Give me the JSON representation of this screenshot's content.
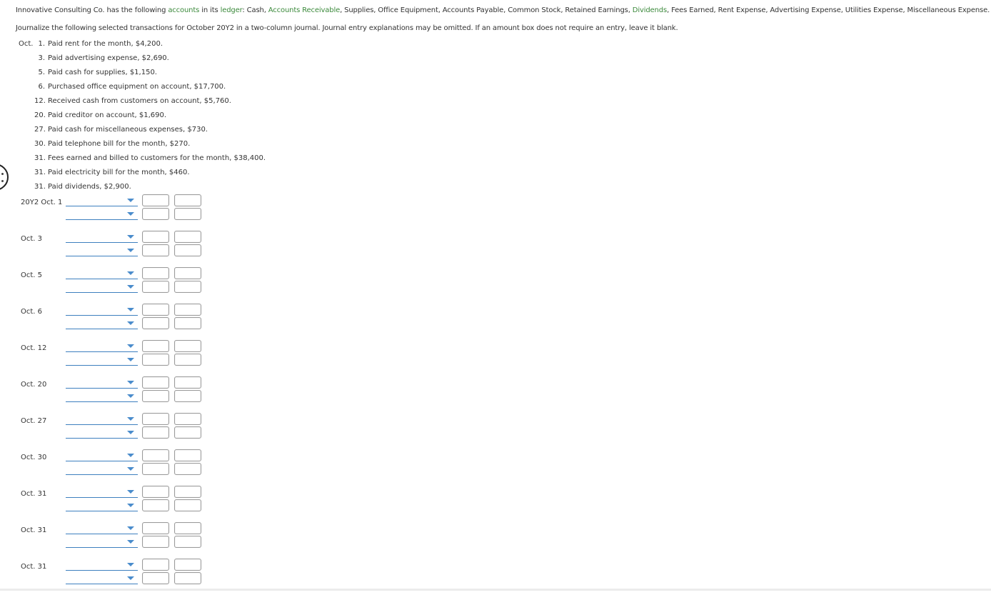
{
  "intro": {
    "parts": [
      {
        "text": "Innovative Consulting Co. has the following ",
        "link": false
      },
      {
        "text": "accounts",
        "link": true
      },
      {
        "text": " in its ",
        "link": false
      },
      {
        "text": "ledger",
        "link": true
      },
      {
        "text": ": Cash, ",
        "link": false
      },
      {
        "text": "Accounts Receivable",
        "link": true
      },
      {
        "text": ", Supplies, Office Equipment, Accounts Payable, Common Stock, Retained Earnings, ",
        "link": false
      },
      {
        "text": "Dividends",
        "link": true
      },
      {
        "text": ", Fees Earned, Rent Expense, Advertising Expense, Utilities Expense, Miscellaneous Expense.",
        "link": false
      }
    ],
    "instructions": "Journalize the following selected transactions for October 20Y2 in a two-column journal. Journal entry explanations may be omitted. If an amount box does not require an entry, leave it blank.",
    "link_color": "#3c8a3c"
  },
  "transactions": [
    {
      "month": "Oct.",
      "day": "1.",
      "text": "Paid rent for the month, $4,200."
    },
    {
      "month": "",
      "day": "3.",
      "text": "Paid advertising expense, $2,690."
    },
    {
      "month": "",
      "day": "5.",
      "text": "Paid cash for supplies, $1,150."
    },
    {
      "month": "",
      "day": "6.",
      "text": "Purchased office equipment on account, $17,700."
    },
    {
      "month": "",
      "day": "12.",
      "text": "Received cash from customers on account, $5,760."
    },
    {
      "month": "",
      "day": "20.",
      "text": "Paid creditor on account, $1,690."
    },
    {
      "month": "",
      "day": "27.",
      "text": "Paid cash for miscellaneous expenses, $730."
    },
    {
      "month": "",
      "day": "30.",
      "text": "Paid telephone bill for the month, $270."
    },
    {
      "month": "",
      "day": "31.",
      "text": "Fees earned and billed to customers for the month, $38,400."
    },
    {
      "month": "",
      "day": "31.",
      "text": "Paid electricity bill for the month, $460."
    },
    {
      "month": "",
      "day": "31.",
      "text": "Paid dividends, $2,900."
    }
  ],
  "journal": {
    "entries": [
      {
        "date": "20Y2 Oct. 1"
      },
      {
        "date": "Oct. 3"
      },
      {
        "date": "Oct. 5"
      },
      {
        "date": "Oct. 6"
      },
      {
        "date": "Oct. 12"
      },
      {
        "date": "Oct. 20"
      },
      {
        "date": "Oct. 27"
      },
      {
        "date": "Oct. 30"
      },
      {
        "date": "Oct. 31"
      },
      {
        "date": "Oct. 31"
      },
      {
        "date": "Oct. 31"
      }
    ],
    "lines_per_entry": 2,
    "account_selected": "",
    "debit_value": "",
    "credit_value": "",
    "accent_color": "#3d7fbf"
  }
}
